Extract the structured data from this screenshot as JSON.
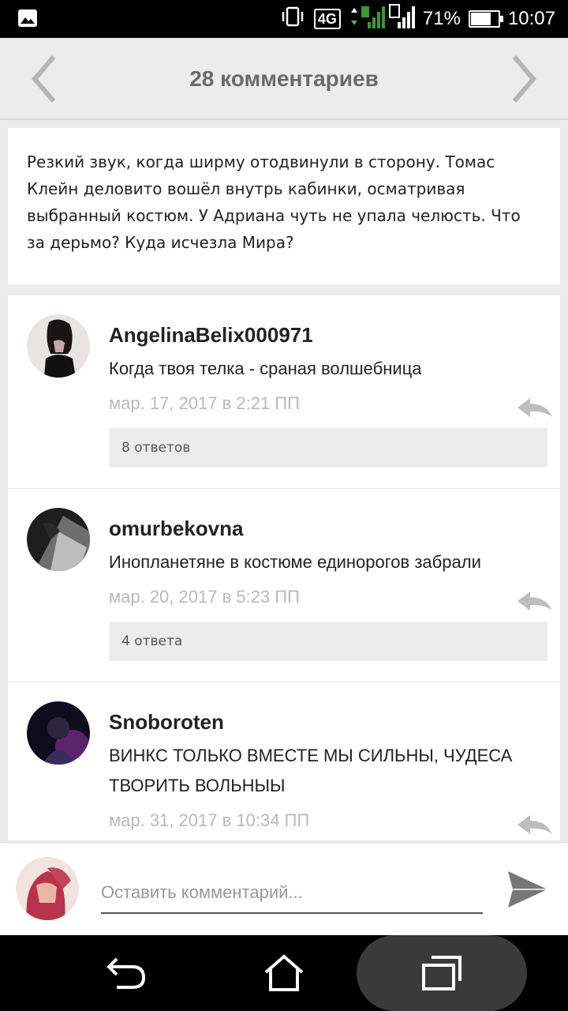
{
  "status_bar": {
    "network": "4G",
    "sim1": "1",
    "sim2": "2",
    "battery": "71%",
    "battery_level": 0.71,
    "time": "10:07",
    "icons": [
      "image-icon",
      "vibrate-icon",
      "signal-icon",
      "battery-icon"
    ]
  },
  "header": {
    "title": "28 комментариев",
    "prev_icon": "chevron-left-icon",
    "next_icon": "chevron-right-icon"
  },
  "story": {
    "text": "Резкий звук, когда ширму отодвинули в сторону. Томас Клейн деловито вошёл внутрь кабинки, осматривая выбранный костюм. У Адриана чуть не упала челюсть. Что за дерьмо? Куда исчезла Мира?"
  },
  "comments": [
    {
      "user": "AngelinaBelix000971",
      "text": "Когда твоя телка - сраная волшебница",
      "date": "мар. 17, 2017 в 2:21 ПП",
      "replies": "8 ответов"
    },
    {
      "user": "omurbekovna",
      "text": "Инопланетяне в костюме единорогов забрали",
      "date": "мар. 20, 2017 в 5:23 ПП",
      "replies": "4 ответа"
    },
    {
      "user": "Snoboroten",
      "text": "ВИНКС ТОЛЬКО ВМЕСТЕ МЫ СИЛЬНЫ, ЧУДЕСА ТВОРИТЬ ВОЛЬНЫЫ",
      "date": "мар. 31, 2017 в 10:34 ПП"
    }
  ],
  "compose": {
    "placeholder": "Оставить комментарий...",
    "send_icon": "send-icon"
  },
  "nav": {
    "icons": [
      "back-icon",
      "home-icon",
      "recent-apps-icon"
    ]
  },
  "colors": {
    "background": "#ececec",
    "date": "#b9b9b9",
    "title": "#6a6a6a"
  }
}
